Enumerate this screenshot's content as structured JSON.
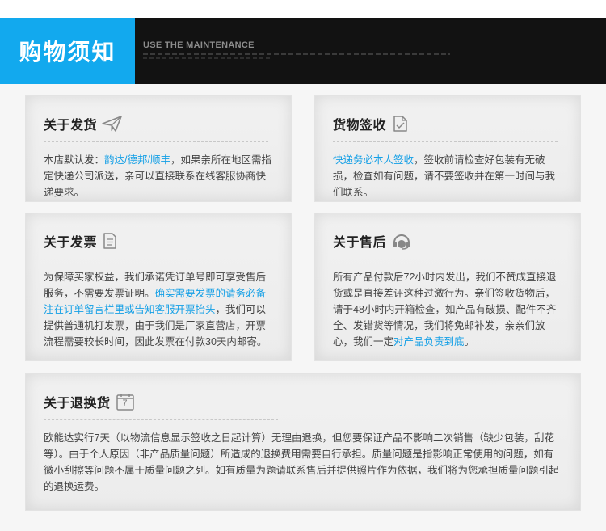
{
  "header": {
    "title": "购物须知",
    "subtitle_en": "USE THE MAINTENANCE",
    "accent_color": "#12a9ee"
  },
  "cards": {
    "shipping": {
      "title": "关于发货",
      "icon": "paper-plane-icon",
      "body_a": "本店默认发：",
      "body_hl": "韵达/德邦/顺丰",
      "body_b": "，如果亲所在地区需指定快递公司派送，亲可以直接联系在线客服协商快递要求。"
    },
    "receipt": {
      "title": "货物签收",
      "icon": "document-icon",
      "body_hl": "快递务必本人签收",
      "body_b": "，签收前请检查好包装有无破损，检查如有问题，请不要签收并在第一时间与我们联系。"
    },
    "invoice": {
      "title": "关于发票",
      "icon": "invoice-icon",
      "body_a": "为保障买家权益，我们承诺凭订单号即可享受售后服务，不需要发票证明。",
      "body_hl": "确实需要发票的请务必备注在订单留言栏里或告知客服开票抬头",
      "body_b": "，我们可以提供普通机打发票，由于我们是厂家直营店，开票流程需要较长时间，因此发票在付款30天内邮寄。"
    },
    "aftersale": {
      "title": "关于售后",
      "icon": "headset-icon",
      "body_a": "所有产品付款后72小时内发出，我们不赞成直接退货或是直接差评这种过激行为。亲们签收货物后，请于48小时内开箱检查，如产品有破损、配件不齐全、发错货等情况，我们将免邮补发，亲亲们放心，我们一定",
      "body_hl": "对产品负责到底",
      "body_b": "。"
    },
    "returns": {
      "title": "关于退换货",
      "icon": "calendar-7-icon",
      "icon_number": "7",
      "body": "欧能达实行7天（以物流信息显示签收之日起计算）无理由退换，但您要保证产品不影响二次销售（缺少包装，刮花等）。由于个人原因（非产品质量问题）所造成的退换费用需要自行承担。质量问题是指影响正常使用的问题，如有微小刮擦等问题不属于质量问题之列。如有质量为题请联系售后并提供照片作为依据，我们将为您承担质量问题引起的退换运费。"
    }
  }
}
